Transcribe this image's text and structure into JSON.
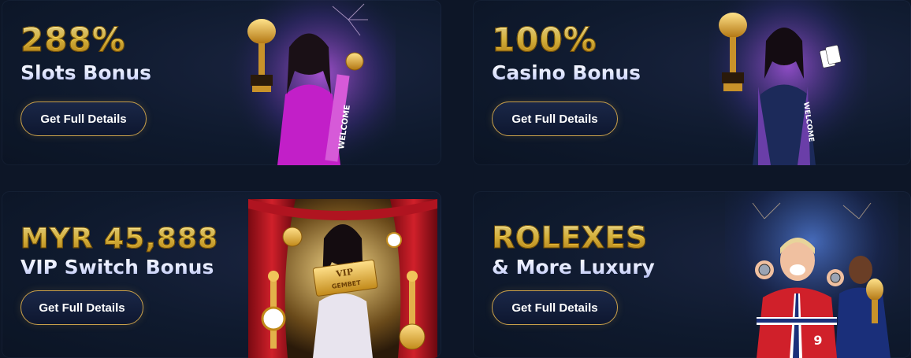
{
  "promos": [
    {
      "headline": "288%",
      "subline": "Slots Bonus",
      "button": "Get Full Details",
      "ribbon": "WELCOME"
    },
    {
      "headline": "100%",
      "subline": "Casino Bonus",
      "button": "Get Full Details",
      "ribbon": "WELCOME"
    },
    {
      "headline": "MYR 45,888",
      "subline": "VIP Switch Bonus",
      "button": "Get Full Details",
      "ticket_line1": "VIP",
      "ticket_line2": "GEMBET"
    },
    {
      "headline": "ROLEXES",
      "subline": "& More Luxury",
      "button": "Get Full Details",
      "jersey_number": "9"
    }
  ],
  "colors": {
    "background": "#0d1627",
    "gold": "#f5cf4a",
    "button_border": "#c9a04a"
  }
}
